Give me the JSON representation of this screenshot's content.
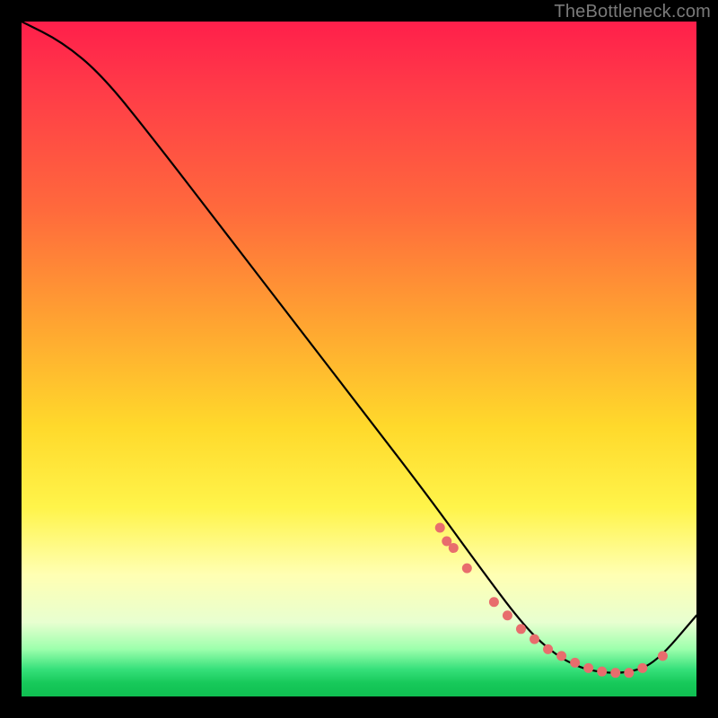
{
  "watermark": "TheBottleneck.com",
  "chart_data": {
    "type": "line",
    "title": "",
    "xlabel": "",
    "ylabel": "",
    "xlim": [
      0,
      100
    ],
    "ylim": [
      0,
      100
    ],
    "grid": false,
    "legend": false,
    "series": [
      {
        "name": "curve",
        "x": [
          0,
          6,
          12,
          20,
          30,
          40,
          50,
          60,
          68,
          74,
          78,
          82,
          86,
          90,
          94,
          100
        ],
        "values": [
          100,
          97,
          92,
          82,
          69,
          56,
          43,
          30,
          19,
          11,
          7,
          4.5,
          3.5,
          3.5,
          5,
          12
        ]
      }
    ],
    "markers": {
      "name": "highlight-dots",
      "color": "#e86d6d",
      "x": [
        62,
        63,
        64,
        66,
        70,
        72,
        74,
        76,
        78,
        80,
        82,
        84,
        86,
        88,
        90,
        92,
        95
      ],
      "values": [
        25,
        23,
        22,
        19,
        14,
        12,
        10,
        8.5,
        7,
        6,
        5,
        4.2,
        3.7,
        3.5,
        3.5,
        4.2,
        6
      ]
    }
  }
}
